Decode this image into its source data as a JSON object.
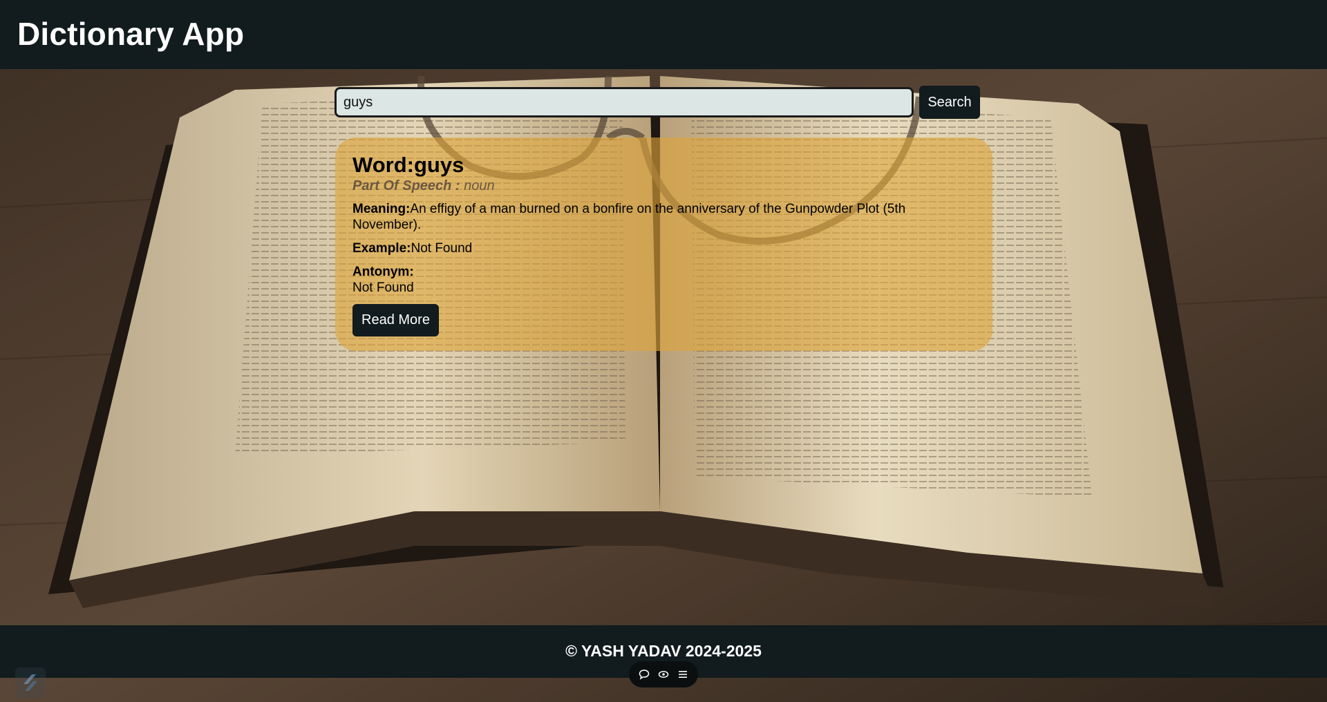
{
  "header": {
    "title": "Dictionary App"
  },
  "search": {
    "value": "guys",
    "button_label": "Search"
  },
  "result": {
    "word_label": "Word:",
    "word": "guys",
    "pos_label": "Part Of Speech : ",
    "pos_value": "noun",
    "meaning_label": "Meaning:",
    "meaning": "An effigy of a man burned on a bonfire on the anniversary of the Gunpowder Plot (5th November).",
    "example_label": "Example:",
    "example": "Not Found",
    "antonym_label": "Antonym:",
    "antonym": "Not Found",
    "read_more_label": "Read More"
  },
  "footer": {
    "text": "© YASH YADAV 2024-2025"
  },
  "toolbar": {
    "icons": [
      "comment-icon",
      "eye-icon",
      "menu-icon"
    ]
  },
  "colors": {
    "header_bg": "#121b1e",
    "card_bg": "#dda53a",
    "input_bg": "#dce6e4",
    "button_bg": "#121b1e"
  }
}
